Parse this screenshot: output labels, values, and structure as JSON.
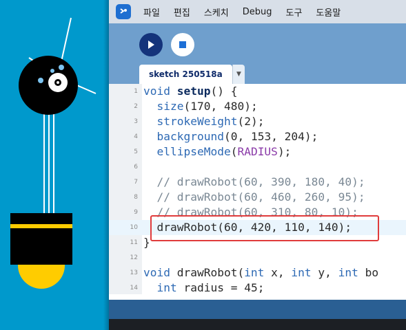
{
  "menu": {
    "items": [
      "파일",
      "편집",
      "스케치",
      "Debug",
      "도구",
      "도움말"
    ]
  },
  "toolbar": {
    "run_icon": "play-icon",
    "stop_icon": "stop-icon"
  },
  "tabs": [
    {
      "label": "sketch 250518a"
    }
  ],
  "editor": {
    "highlighted_line": 10,
    "lines": [
      {
        "n": "1"
      },
      {
        "n": "2"
      },
      {
        "n": "3"
      },
      {
        "n": "4"
      },
      {
        "n": "5"
      },
      {
        "n": "6"
      },
      {
        "n": "7"
      },
      {
        "n": "8"
      },
      {
        "n": "9"
      },
      {
        "n": "10"
      },
      {
        "n": "11"
      },
      {
        "n": "12"
      },
      {
        "n": "13"
      },
      {
        "n": "14"
      }
    ],
    "tokens": {
      "l1_a": "void",
      "l1_b": "setup",
      "l1_c": "() {",
      "l2_a": "  ",
      "l2_b": "size",
      "l2_c": "(170, 480);",
      "l3_a": "  ",
      "l3_b": "strokeWeight",
      "l3_c": "(2);",
      "l4_a": "  ",
      "l4_b": "background",
      "l4_c": "(0, 153, 204);",
      "l5_a": "  ",
      "l5_b": "ellipseMode",
      "l5_c": "(",
      "l5_d": "RADIUS",
      "l5_e": ");",
      "l7": "  // drawRobot(60, 390, 180, 40);",
      "l8": "  // drawRobot(60, 460, 260, 95);",
      "l9": "  // drawRobot(60, 310, 80, 10);",
      "l10": "  drawRobot(60, 420, 110, 140);",
      "l11": "}",
      "l13_a": "void",
      "l13_b": " drawRobot(",
      "l13_c": "int",
      "l13_d": " x, ",
      "l13_e": "int",
      "l13_f": " y, ",
      "l13_g": "int",
      "l13_h": " bo",
      "l14_a": "  ",
      "l14_b": "int",
      "l14_c": " radius = 45;"
    }
  },
  "colors": {
    "sketch_bg": "#0099cc",
    "ide_bg": "#6f9fcd",
    "highlight": "#e03b3b",
    "robot_accent": "#ffcc00"
  }
}
